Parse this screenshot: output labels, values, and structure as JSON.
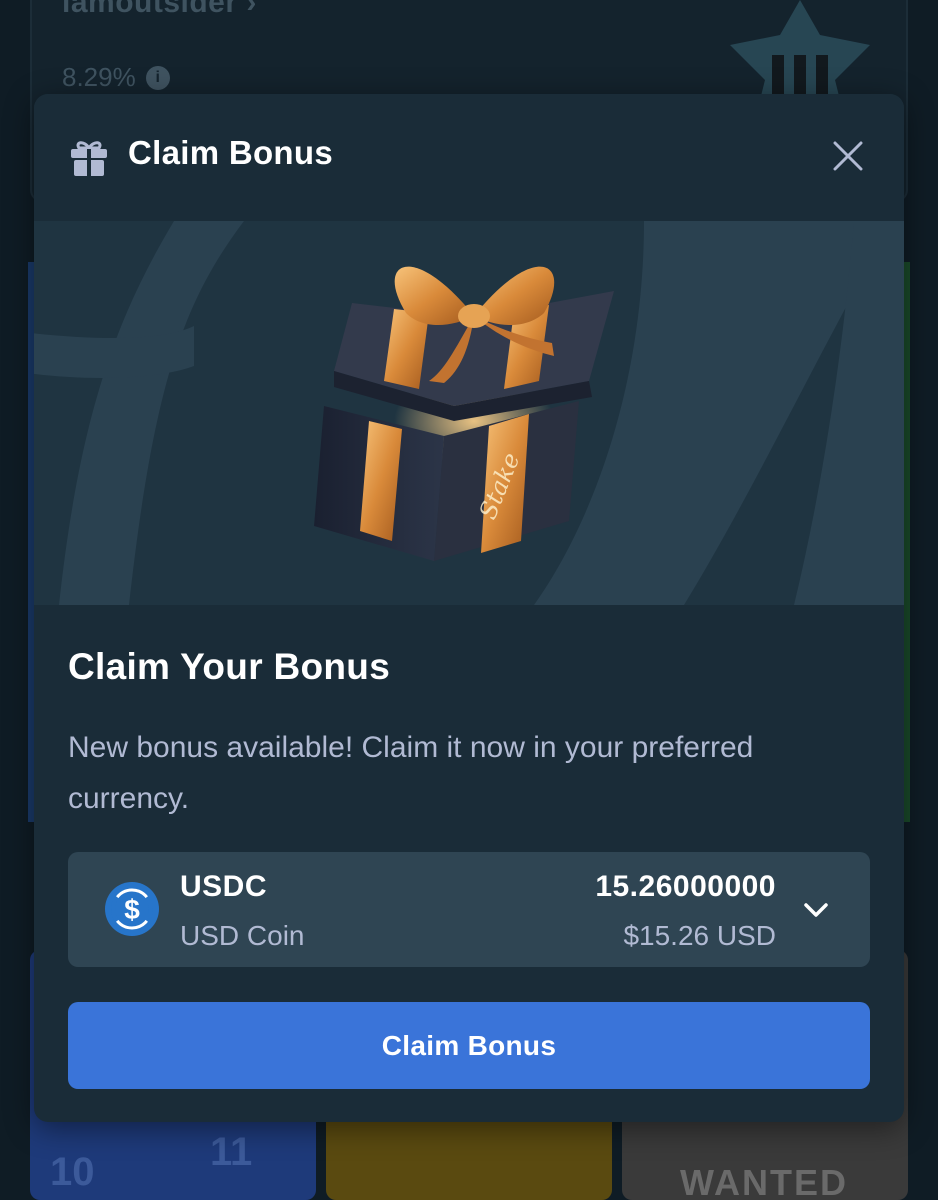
{
  "background": {
    "username": "iamoutsider",
    "username_chevron": "›",
    "percent": "8.29%",
    "info_icon": "info-icon",
    "tile_numbers": [
      "10",
      "11"
    ],
    "tile_label": "WANTED"
  },
  "modal": {
    "header": {
      "icon": "gift-icon",
      "title": "Claim Bonus",
      "close_icon": "close-icon"
    },
    "hero": {
      "image": "gift-box-illustration",
      "ribbon_text": "Stake"
    },
    "content": {
      "title": "Claim Your Bonus",
      "description": "New bonus available! Claim it now in your preferred currency."
    },
    "currency": {
      "icon": "usdc-coin-icon",
      "symbol": "USDC",
      "name": "USD Coin",
      "amount": "15.26000000",
      "usd_value": "$15.26 USD",
      "dropdown_icon": "chevron-down-icon"
    },
    "claim_button": {
      "label": "Claim Bonus"
    }
  },
  "colors": {
    "page_bg": "#0f1c25",
    "modal_bg": "#1a2c38",
    "hero_bg": "#1f3441",
    "select_bg": "#2f4553",
    "text_secondary": "#b1bad3",
    "button_blue": "#3a74d9",
    "usdc_blue": "#2775ca"
  }
}
